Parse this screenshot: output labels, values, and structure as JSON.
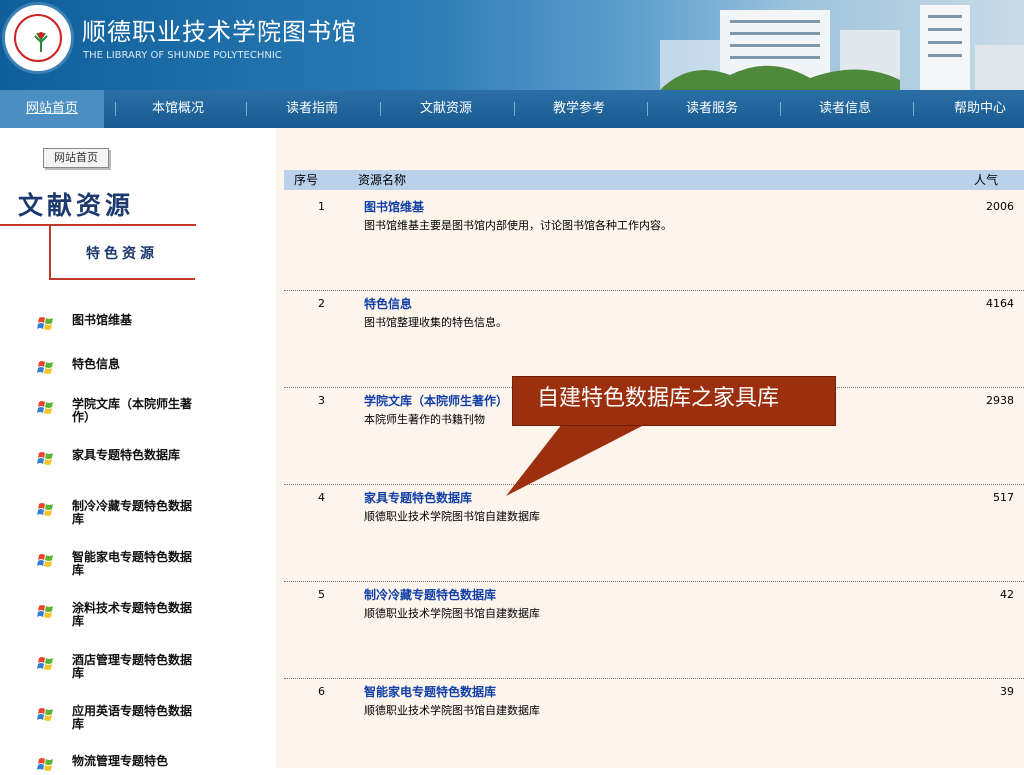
{
  "header": {
    "title": "顺德职业技术学院图书馆",
    "subtitle": "THE LIBRARY OF SHUNDE POLYTECHNIC"
  },
  "nav": {
    "items": [
      "网站首页",
      "本馆概况",
      "读者指南",
      "文献资源",
      "教学参考",
      "读者服务",
      "读者信息",
      "帮助中心"
    ],
    "active_index": 0
  },
  "sidebar": {
    "home_button": "网站首页",
    "section_title": "文献资源",
    "sub_title": "特色资源",
    "items": [
      "图书馆维基",
      "特色信息",
      "学院文库（本院师生著作）",
      "家具专题特色数据库",
      "制冷冷藏专题特色数据库",
      "智能家电专题特色数据库",
      "涂料技术专题特色数据库",
      "酒店管理专题特色数据库",
      "应用英语专题特色数据库",
      "物流管理专题特色"
    ]
  },
  "table": {
    "headers": {
      "no": "序号",
      "name": "资源名称",
      "popularity": "人气"
    },
    "rows": [
      {
        "no": "1",
        "name": "图书馆维基",
        "desc": "图书馆维基主要是图书馆内部使用，讨论图书馆各种工作内容。",
        "popularity": "2006"
      },
      {
        "no": "2",
        "name": "特色信息",
        "desc": "图书馆整理收集的特色信息。",
        "popularity": "4164"
      },
      {
        "no": "3",
        "name": "学院文库（本院师生著作）",
        "desc": "本院师生著作的书籍刊物",
        "popularity": "2938"
      },
      {
        "no": "4",
        "name": "家具专题特色数据库",
        "desc": "顺德职业技术学院图书馆自建数据库",
        "popularity": "517"
      },
      {
        "no": "5",
        "name": "制冷冷藏专题特色数据库",
        "desc": "顺德职业技术学院图书馆自建数据库",
        "popularity": "42"
      },
      {
        "no": "6",
        "name": "智能家电专题特色数据库",
        "desc": "顺德职业技术学院图书馆自建数据库",
        "popularity": "39"
      }
    ]
  },
  "callout": {
    "text": "自建特色数据库之家具库"
  },
  "colors": {
    "header_blue": "#0f5f9b",
    "nav_blue": "#175b91",
    "table_header": "#b9d1ea",
    "link_blue": "#1240a8",
    "callout": "#9b2f0e",
    "accent_red": "#c0392b"
  },
  "icons": {
    "logo": "library-seal-logo",
    "sidebar_item": "windows-flag-icon"
  }
}
